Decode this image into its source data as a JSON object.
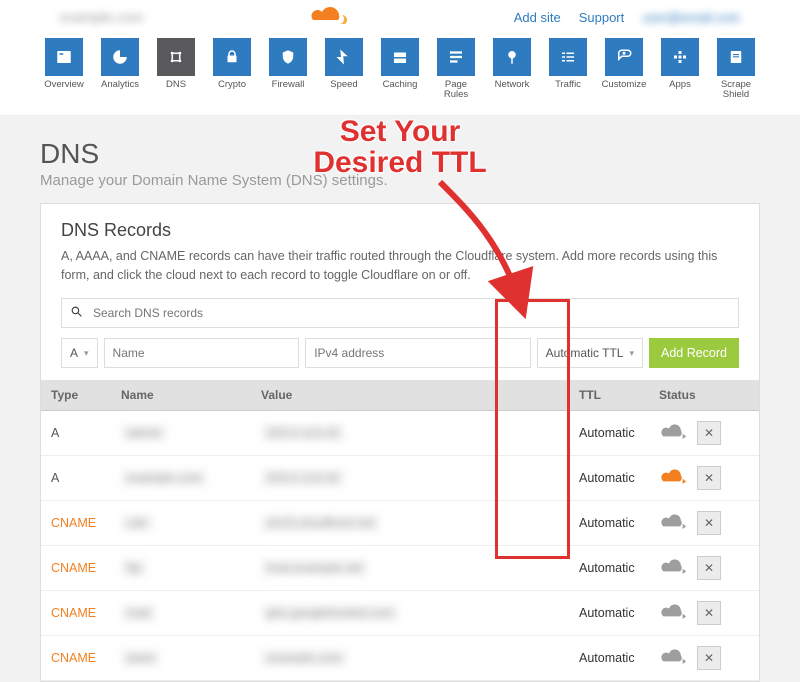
{
  "header": {
    "domain_blurred": "example.com",
    "links": {
      "add_site": "Add site",
      "support": "Support",
      "email_blurred": "user@email.com"
    }
  },
  "nav": [
    {
      "id": "overview",
      "label": "Overview",
      "icon": "overview-icon"
    },
    {
      "id": "analytics",
      "label": "Analytics",
      "icon": "analytics-icon"
    },
    {
      "id": "dns",
      "label": "DNS",
      "icon": "dns-icon",
      "active": true
    },
    {
      "id": "crypto",
      "label": "Crypto",
      "icon": "crypto-icon"
    },
    {
      "id": "firewall",
      "label": "Firewall",
      "icon": "firewall-icon"
    },
    {
      "id": "speed",
      "label": "Speed",
      "icon": "speed-icon"
    },
    {
      "id": "caching",
      "label": "Caching",
      "icon": "caching-icon"
    },
    {
      "id": "pagerules",
      "label": "Page Rules",
      "icon": "pagerules-icon"
    },
    {
      "id": "network",
      "label": "Network",
      "icon": "network-icon"
    },
    {
      "id": "traffic",
      "label": "Traffic",
      "icon": "traffic-icon"
    },
    {
      "id": "customize",
      "label": "Customize",
      "icon": "customize-icon"
    },
    {
      "id": "apps",
      "label": "Apps",
      "icon": "apps-icon"
    },
    {
      "id": "scrapeshield",
      "label": "Scrape Shield",
      "icon": "scrapeshield-icon"
    }
  ],
  "page": {
    "title": "DNS",
    "subtitle": "Manage your Domain Name System (DNS) settings."
  },
  "panel": {
    "heading": "DNS Records",
    "description": "A, AAAA, and CNAME records can have their traffic routed through the Cloudflare system. Add more records using this form, and click the cloud next to each record to toggle Cloudflare on or off.",
    "search_placeholder": "Search DNS records",
    "add": {
      "type_selected": "A",
      "name_placeholder": "Name",
      "value_placeholder": "IPv4 address",
      "ttl_selected": "Automatic TTL",
      "button": "Add Record"
    },
    "columns": {
      "type": "Type",
      "name": "Name",
      "value": "Value",
      "ttl": "TTL",
      "status": "Status"
    },
    "rows": [
      {
        "type": "A",
        "name_blurred": "admin",
        "value_blurred": "203.0.113.42",
        "ttl": "Automatic",
        "proxied": false
      },
      {
        "type": "A",
        "name_blurred": "example.com",
        "value_blurred": "203.0.113.42",
        "ttl": "Automatic",
        "proxied": true
      },
      {
        "type": "CNAME",
        "name_blurred": "cdn",
        "value_blurred": "d123.cloudfront.net",
        "ttl": "Automatic",
        "proxied": false
      },
      {
        "type": "CNAME",
        "name_blurred": "ftp",
        "value_blurred": "host.example.net",
        "ttl": "Automatic",
        "proxied": false
      },
      {
        "type": "CNAME",
        "name_blurred": "mail",
        "value_blurred": "ghs.googlehosted.com",
        "ttl": "Automatic",
        "proxied": false
      },
      {
        "type": "CNAME",
        "name_blurred": "www",
        "value_blurred": "example.com",
        "ttl": "Automatic",
        "proxied": false
      }
    ]
  },
  "annotation": {
    "text_line1": "Set Your",
    "text_line2": "Desired TTL"
  },
  "colors": {
    "blue": "#2f7bbf",
    "orange": "#f38020",
    "green": "#9bca3e",
    "red": "#e03131"
  }
}
